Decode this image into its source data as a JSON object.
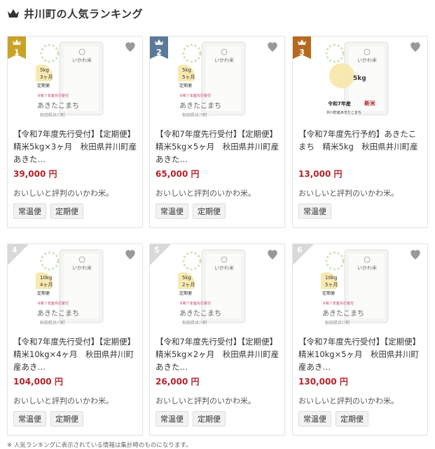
{
  "header": {
    "title": "井川町の人気ランキング",
    "icon": "crown-icon"
  },
  "colors": {
    "gold": "#c9a227",
    "silver": "#5b7a99",
    "bronze": "#b56a1f",
    "price": "#b3232a"
  },
  "products": [
    {
      "rank": "1",
      "name": "【令和7年度先行受付】【定期便】精米5kg×3ヶ月　秋田県井川町産あきた…",
      "price": "39,000 円",
      "desc": "おいしいと評判のいかわ米。",
      "tags": [
        "常温便",
        "定期便"
      ],
      "bag_label": "5kg\n3ヶ月",
      "bag_sub": "定期便",
      "bag_text": "あきたこまち",
      "bag_small": "秋田県井川町"
    },
    {
      "rank": "2",
      "name": "【令和7年度先行受付】【定期便】精米5kg×5ヶ月　秋田県井川町産あきた…",
      "price": "65,000 円",
      "desc": "おいしいと評判のいかわ米。",
      "tags": [
        "常温便",
        "定期便"
      ],
      "bag_label": "5kg\n5ヶ月",
      "bag_sub": "定期便",
      "bag_text": "あきたこまち",
      "bag_small": "秋田県井川町"
    },
    {
      "rank": "3",
      "name": "【令和7年度先行予約】あきたこまち　精米5kg　秋田県井川町産",
      "price": "13,000 円",
      "desc": "おいしいと評判のいかわ米。",
      "tags": [
        "常温便"
      ],
      "bag_label": "5kg",
      "bag_sub": "令和7年産 新米",
      "bag_text": "",
      "bag_small": "井川町産あきたこまち"
    },
    {
      "rank": "4",
      "name": "【令和7年度先行受付】【定期便】精米10kg×4ヶ月　秋田県井川町産あき…",
      "price": "104,000 円",
      "desc": "おいしいと評判のいかわ米。",
      "tags": [
        "常温便",
        "定期便"
      ],
      "bag_label": "10kg\n4ヶ月",
      "bag_sub": "定期便",
      "bag_text": "あきたこまち",
      "bag_small": "秋田県井川町"
    },
    {
      "rank": "5",
      "name": "【令和7年度先行受付】【定期便】精米5kg×2ヶ月　秋田県井川町産あきた…",
      "price": "26,000 円",
      "desc": "おいしいと評判のいかわ米。",
      "tags": [
        "常温便",
        "定期便"
      ],
      "bag_label": "5kg\n2ヶ月",
      "bag_sub": "定期便",
      "bag_text": "あきたこまち",
      "bag_small": "秋田県井川町"
    },
    {
      "rank": "6",
      "name": "【令和7年度先行受付】【定期便】精米10kg×5ヶ月　秋田県井川町産あき…",
      "price": "130,000 円",
      "desc": "おいしいと評判のいかわ米。",
      "tags": [
        "常温便",
        "定期便"
      ],
      "bag_label": "10kg\n5ヶ月",
      "bag_sub": "定期便",
      "bag_text": "あきたこまち",
      "bag_small": "秋田県井川町"
    }
  ],
  "footnote": "※ 人気ランキングに表示されている情報は集計時のものになります。"
}
